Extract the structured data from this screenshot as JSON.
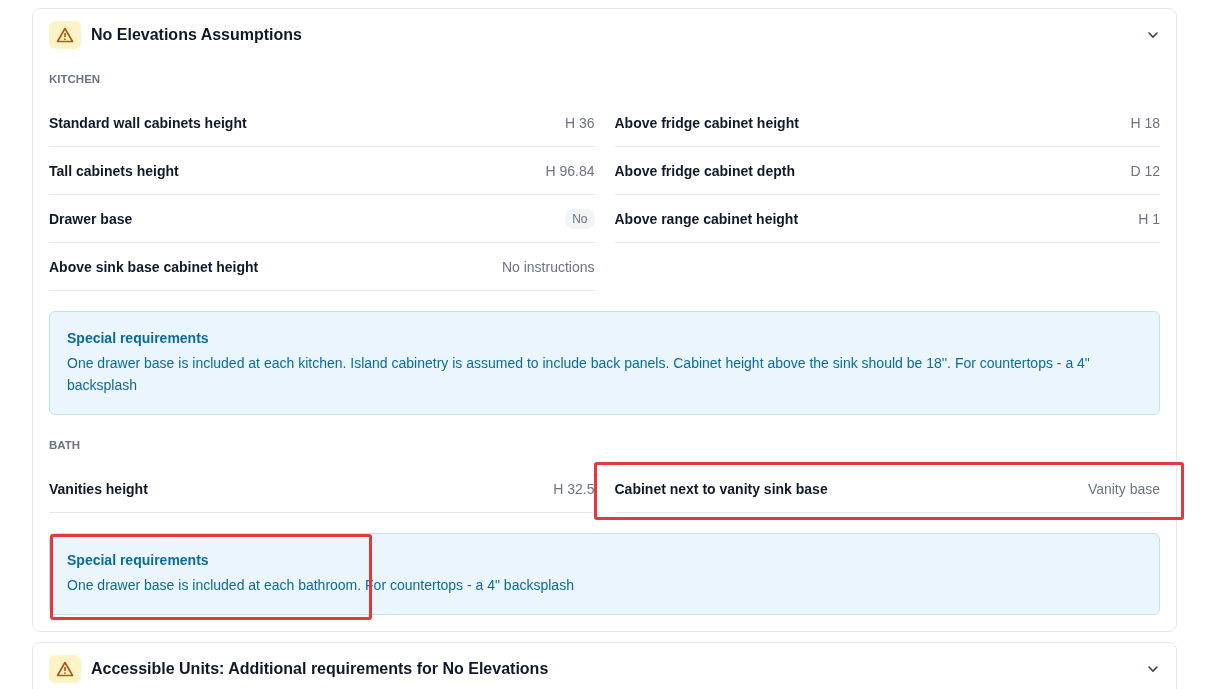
{
  "sections": [
    {
      "title": "No Elevations Assumptions",
      "groups": [
        {
          "heading": "KITCHEN",
          "columns": [
            [
              {
                "label": "Standard wall cabinets height",
                "value": "H 36",
                "kind": "text",
                "highlighted": false
              },
              {
                "label": "Tall cabinets height",
                "value": "H 96.84",
                "kind": "text",
                "highlighted": false
              },
              {
                "label": "Drawer base",
                "value": "No",
                "kind": "pill",
                "highlighted": false
              },
              {
                "label": "Above sink base cabinet height",
                "value": "No instructions",
                "kind": "text",
                "highlighted": false
              }
            ],
            [
              {
                "label": "Above fridge cabinet height",
                "value": "H 18",
                "kind": "text",
                "highlighted": false
              },
              {
                "label": "Above fridge cabinet depth",
                "value": "D 12",
                "kind": "text",
                "highlighted": false
              },
              {
                "label": "Above range cabinet height",
                "value": "H 1",
                "kind": "text",
                "highlighted": false
              }
            ]
          ],
          "note": {
            "title": "Special requirements",
            "text": "One drawer base is included at each kitchen. Island cabinetry is assumed to include back panels. Cabinet height above the sink should be 18''. For countertops - a 4\" backsplash",
            "highlighted": false
          }
        },
        {
          "heading": "BATH",
          "columns": [
            [
              {
                "label": "Vanities height",
                "value": "H 32.5",
                "kind": "text",
                "highlighted": false
              }
            ],
            [
              {
                "label": "Cabinet next to vanity sink base",
                "value": "Vanity base",
                "kind": "text",
                "highlighted": true
              }
            ]
          ],
          "note": {
            "title": "Special requirements",
            "text": "One drawer base is included at each bathroom. For countertops - a 4\" backsplash",
            "highlighted": true
          }
        }
      ]
    },
    {
      "title": "Accessible Units: Additional requirements for No Elevations"
    }
  ]
}
